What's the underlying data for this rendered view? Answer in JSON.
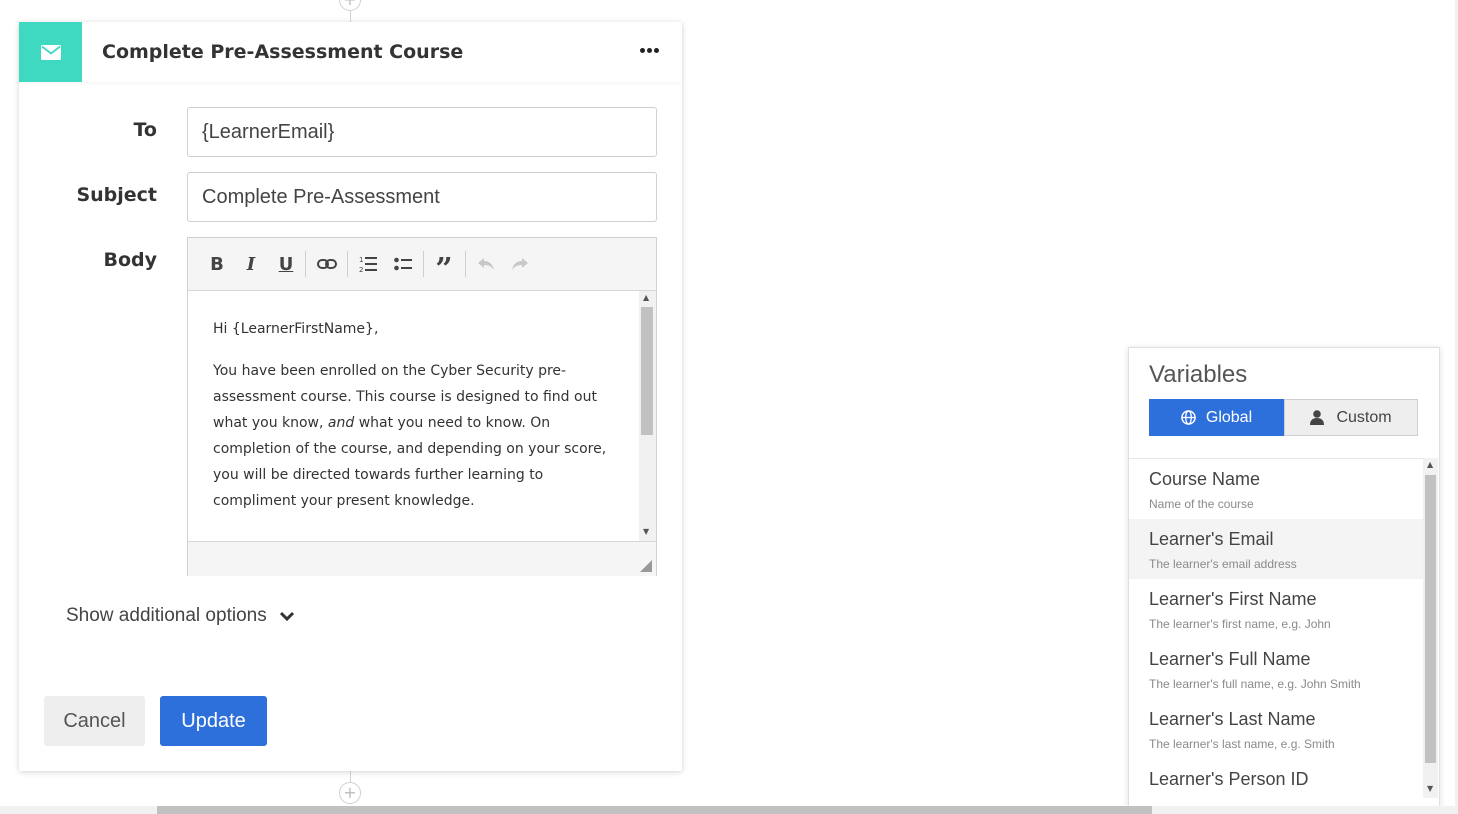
{
  "card": {
    "title": "Complete Pre-Assessment Course",
    "icon": "envelope-icon",
    "accent_color": "#3fd9c2"
  },
  "form": {
    "to_label": "To",
    "to_value": "{LearnerEmail}",
    "subject_label": "Subject",
    "subject_value": "Complete Pre-Assessment",
    "body_label": "Body"
  },
  "toolbar": {
    "bold": "B",
    "italic": "I",
    "underline": "U",
    "buttons": [
      "bold",
      "italic",
      "underline",
      "link",
      "ordered-list",
      "bullet-list",
      "blockquote",
      "undo",
      "redo"
    ]
  },
  "editor": {
    "greeting": "Hi {LearnerFirstName},",
    "para1_part1": "You have been enrolled on the Cyber Security pre-assessment course. This course is designed to find out what you know, ",
    "para1_em": "and",
    "para1_part2": " what you need to know. On completion of the course, and depending on your score, you will be directed towards further learning to compliment your present knowledge."
  },
  "options": {
    "show_additional": "Show additional options"
  },
  "actions": {
    "cancel": "Cancel",
    "update": "Update",
    "primary_color": "#2d6fdb"
  },
  "variables": {
    "title": "Variables",
    "tabs": [
      {
        "label": "Global",
        "icon": "globe-icon",
        "active": true
      },
      {
        "label": "Custom",
        "icon": "user-icon",
        "active": false
      }
    ],
    "items": [
      {
        "name": "Course Name",
        "desc": "Name of the course"
      },
      {
        "name": "Learner's Email",
        "desc": "The learner's email address"
      },
      {
        "name": "Learner's First Name",
        "desc": "The learner's first name, e.g. John"
      },
      {
        "name": "Learner's Full Name",
        "desc": "The learner's full name, e.g. John Smith"
      },
      {
        "name": "Learner's Last Name",
        "desc": "The learner's last name, e.g. Smith"
      },
      {
        "name": "Learner's Person ID",
        "desc": ""
      }
    ]
  }
}
